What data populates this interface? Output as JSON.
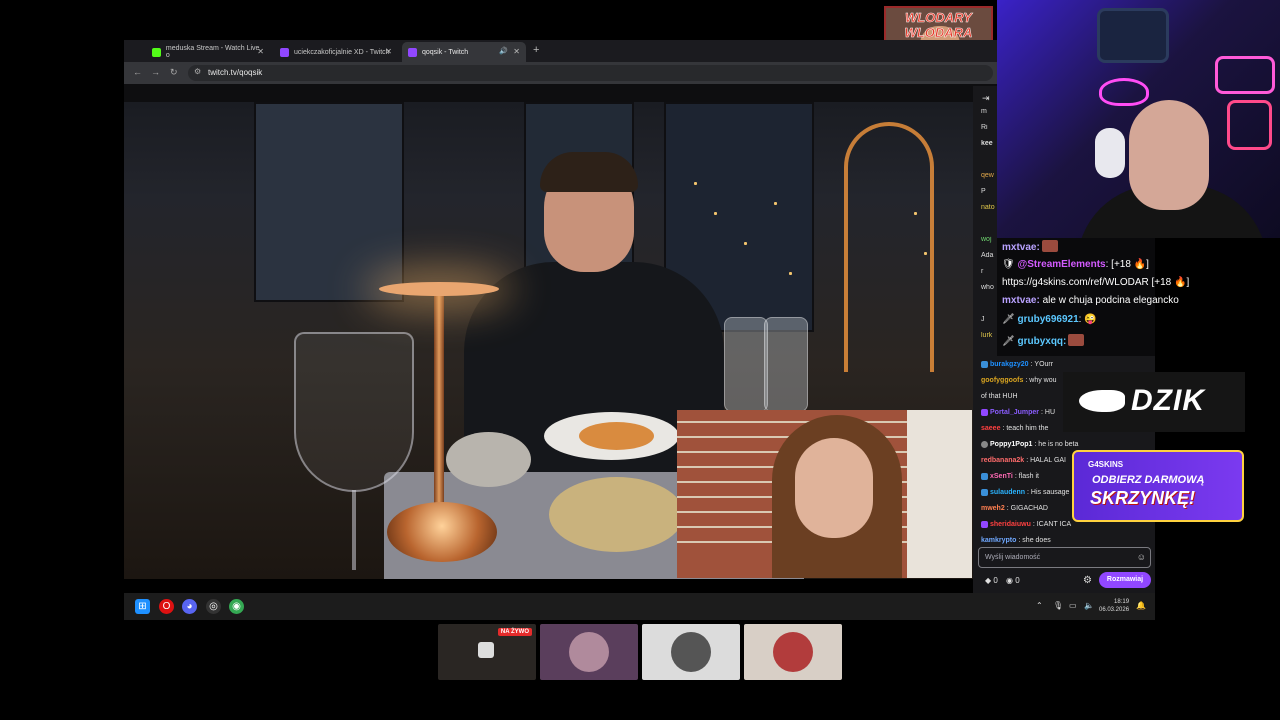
{
  "browser": {
    "tabs": [
      {
        "label": "meduska Stream - Watch Live o",
        "favicon_color": "#53fc18"
      },
      {
        "label": "uciekczakoficjalnie XD - Twitch",
        "favicon_color": "#9147ff"
      },
      {
        "label": "qoqsik - Twitch",
        "favicon_color": "#9147ff",
        "active": true
      }
    ],
    "url": "twitch.tv/qoqsik"
  },
  "logo": {
    "text": "WLODARY WLODARA"
  },
  "chat": {
    "partial_lines": [
      "m",
      "Ri",
      "kee",
      "",
      "qew",
      "P",
      "nato",
      "",
      "woj",
      "Ada",
      "r",
      "who",
      "",
      "J",
      "lurk"
    ],
    "messages": [
      {
        "user": "burakgzy20",
        "text": "YOurr",
        "color": "#1e90ff",
        "badge": "#3a8fd8"
      },
      {
        "user": "goofyggoofs",
        "text": "why wou",
        "color": "#daa520",
        "badge": ""
      },
      {
        "user": "",
        "text": "of that HUH",
        "color": "#ffffff",
        "badge": ""
      },
      {
        "user": "Portal_Jumper",
        "text": "HU",
        "color": "#8a5cff",
        "badge": "#9147ff"
      },
      {
        "user": "saeee",
        "text": "teach him the",
        "color": "#ff4040",
        "badge": ""
      },
      {
        "user": "Poppy1Pop1",
        "text": "he is no beta",
        "color": "#ffffff",
        "badge": "#888888"
      },
      {
        "user": "redbanana2k",
        "text": "HALAL GAI",
        "color": "#ff6b6b",
        "badge": ""
      },
      {
        "user": "xSenTi",
        "text": "flash it",
        "color": "#ff69b4",
        "badge": "#3a8fd8"
      },
      {
        "user": "sulaudenn",
        "text": "His sausage",
        "color": "#2ab4ff",
        "badge": "#3a8fd8"
      },
      {
        "user": "mweh2",
        "text": "GIGACHAD",
        "color": "#ff7f50",
        "badge": ""
      },
      {
        "user": "sheridaiuwu",
        "text": "ICANT ICA",
        "color": "#ff4040",
        "badge": "#9147ff"
      },
      {
        "user": "kamkrypto",
        "text": "she does",
        "color": "#6fa8ff",
        "badge": ""
      }
    ],
    "input_placeholder": "Wyślij wiadomość",
    "points1": "0",
    "points2": "0",
    "send_label": "Rozmawiaj"
  },
  "taskbar": {
    "time": "18:19",
    "date": "06.03.2026"
  },
  "overlay": {
    "lines": [
      {
        "name": "mxtvae:",
        "name_color": "#b9a2ff",
        "text": "",
        "emote": true
      },
      {
        "name": "@StreamElements",
        "name_color": "#d35bff",
        "text": ": [+18 🔥]",
        "emote": false,
        "prefix": "🛡 "
      },
      {
        "name": "",
        "name_color": "#ffffff",
        "text": "https://g4skins.com/ref/WLODAR [+18 🔥]",
        "emote": false
      },
      {
        "name": "mxtvae:",
        "name_color": "#b9a2ff",
        "text": " ale w chuja podcina elegancko",
        "emote": false
      },
      {
        "name": "gruby696921",
        "name_color": "#5cc8ff",
        "text": ": 😜",
        "emote": false,
        "prefix": "🗡 "
      },
      {
        "name": "grubyxqq:",
        "name_color": "#5cc8ff",
        "text": "",
        "emote": true,
        "prefix": "🗡 "
      }
    ]
  },
  "dzik": {
    "text": "DZIK"
  },
  "g4skins": {
    "brand": "G4SKINS",
    "line1": "ODBIERZ DARMOWĄ",
    "line2": "SKRZYNKĘ!"
  },
  "thumbs": [
    {
      "live_label": "NA ŻYWO",
      "bg": "#2a2623"
    },
    {
      "bg": "#5a3e5c"
    },
    {
      "bg": "#dcdcdc"
    },
    {
      "bg": "#d8cfc6"
    }
  ]
}
